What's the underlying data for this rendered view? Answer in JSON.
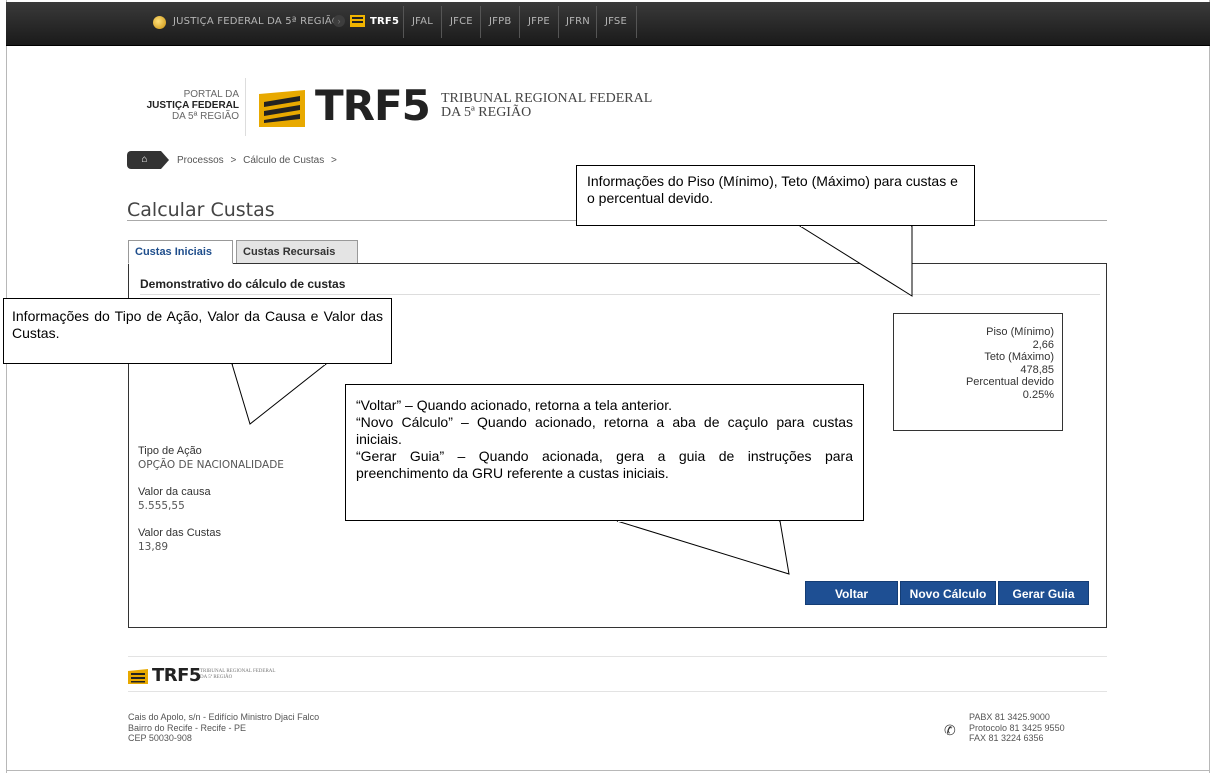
{
  "topbar": {
    "portal_label": "JUSTIÇA FEDERAL DA 5ª REGIÃO",
    "sections": [
      "TRF5",
      "JFAL",
      "JFCE",
      "JFPB",
      "JFPE",
      "JFRN",
      "JFSE"
    ]
  },
  "header": {
    "portal_lines": [
      "PORTAL DA",
      "JUSTIÇA FEDERAL",
      "DA 5ª REGIÃO"
    ],
    "logo_text": "TRF5",
    "tribunal_lines": [
      "TRIBUNAL REGIONAL FEDERAL",
      "DA 5ª REGIÃO"
    ]
  },
  "breadcrumb": {
    "items": [
      "Processos",
      ">",
      "Cálculo de Custas",
      ">"
    ]
  },
  "page": {
    "title": "Calcular Custas"
  },
  "tabs": [
    {
      "label": "Custas Iniciais",
      "active": true
    },
    {
      "label": "Custas Recursais",
      "active": false
    }
  ],
  "panel": {
    "heading": "Demonstrativo do cálculo de custas",
    "tipo_label": "Tipo de Ação",
    "tipo_value": "OPÇÃO DE NACIONALIDADE",
    "valor_causa_label": "Valor da causa",
    "valor_causa_value": "5.555,55",
    "valor_custas_label": "Valor das Custas",
    "valor_custas_value": "13,89"
  },
  "limits": {
    "piso_label": "Piso (Mínimo)",
    "piso_value": "2,66",
    "teto_label": "Teto (Máximo)",
    "teto_value": "478,85",
    "percentual_label": "Percentual devido",
    "percentual_value": "0.25%"
  },
  "buttons": {
    "voltar": "Voltar",
    "novo": "Novo Cálculo",
    "gerar": "Gerar Guia"
  },
  "callouts": {
    "limits_note": "Informações do Piso (Mínimo), Teto (Máximo) para custas e o percentual devido.",
    "info_note": "Informações do Tipo de Ação, Valor da Causa e Valor das Custas.",
    "buttons_note_lines": [
      "“Voltar” – Quando acionado, retorna a tela anterior.",
      "“Novo Cálculo” – Quando acionado, retorna a aba de caçulo para custas iniciais.",
      "“Gerar Guia” – Quando acionada, gera a guia de instruções para preenchimento da GRU referente a custas iniciais."
    ]
  },
  "footer": {
    "logo_text": "TRF5",
    "tribunal_lines": [
      "TRIBUNAL REGIONAL FEDERAL",
      "DA 5ª REGIÃO"
    ],
    "address_lines": [
      "Cais do Apolo, s/n - Edifício Ministro Djaci Falco",
      "Bairro do Recife - Recife - PE",
      "CEP 50030-908"
    ],
    "contact_lines": [
      "PABX 81 3425.9000",
      "Protocolo 81 3425 9550",
      "FAX 81 3224 6356"
    ]
  },
  "colors": {
    "accent": "#1e4f93",
    "topbar": "#222222"
  }
}
